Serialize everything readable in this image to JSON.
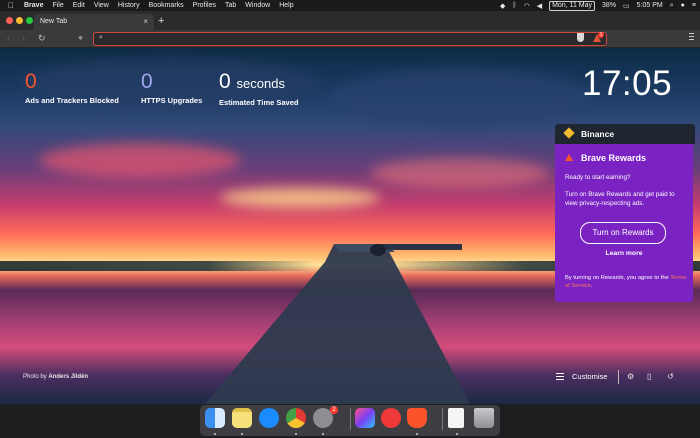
{
  "menubar": {
    "apple": "",
    "items": [
      "Brave",
      "File",
      "Edit",
      "View",
      "History",
      "Bookmarks",
      "Profiles",
      "Tab",
      "Window",
      "Help"
    ],
    "date": "Mon, 11 May",
    "battery": "38%",
    "time": "5:05 PM"
  },
  "tab": {
    "title": "New Tab",
    "close": "×",
    "new": "+"
  },
  "toolbar": {
    "back": "‹",
    "forward": "›",
    "reload": "↻",
    "bookmark": "⌖",
    "search_icon": "⌕",
    "rewards_badge": "1"
  },
  "stats": {
    "ads": {
      "value": "0",
      "label": "Ads and Trackers Blocked",
      "color": "#fb542b"
    },
    "https": {
      "value": "0",
      "label": "HTTPS Upgrades",
      "color": "#a0a5eb"
    },
    "time": {
      "value": "0",
      "unit": "seconds",
      "label": "Estimated Time Saved"
    }
  },
  "clock": "17:05",
  "binance": {
    "title": "Binance"
  },
  "rewards": {
    "title": "Brave Rewards",
    "lead": "Ready to start earning?",
    "description": "Turn on Brave Rewards and get paid to view privacy-respecting ads.",
    "button": "Turn on Rewards",
    "learn_more": "Learn more",
    "terms_prefix": "By turning on Rewards, you agree to the",
    "terms_link": "Terms of Service",
    "terms_suffix": "."
  },
  "footer": {
    "photo_by": "Photo by",
    "photographer": "Anders Jildén",
    "customise": "Customise",
    "settings_icon": "⚙",
    "bookmarks_icon": "▯",
    "history_icon": "↺"
  },
  "dock": {
    "apps": [
      "Finder",
      "Notes",
      "App Store",
      "Chrome",
      "System Preferences",
      "Final Cut Pro",
      "Vivaldi",
      "Brave",
      "Document",
      "Trash"
    ],
    "sysprefs_badge": "2"
  }
}
